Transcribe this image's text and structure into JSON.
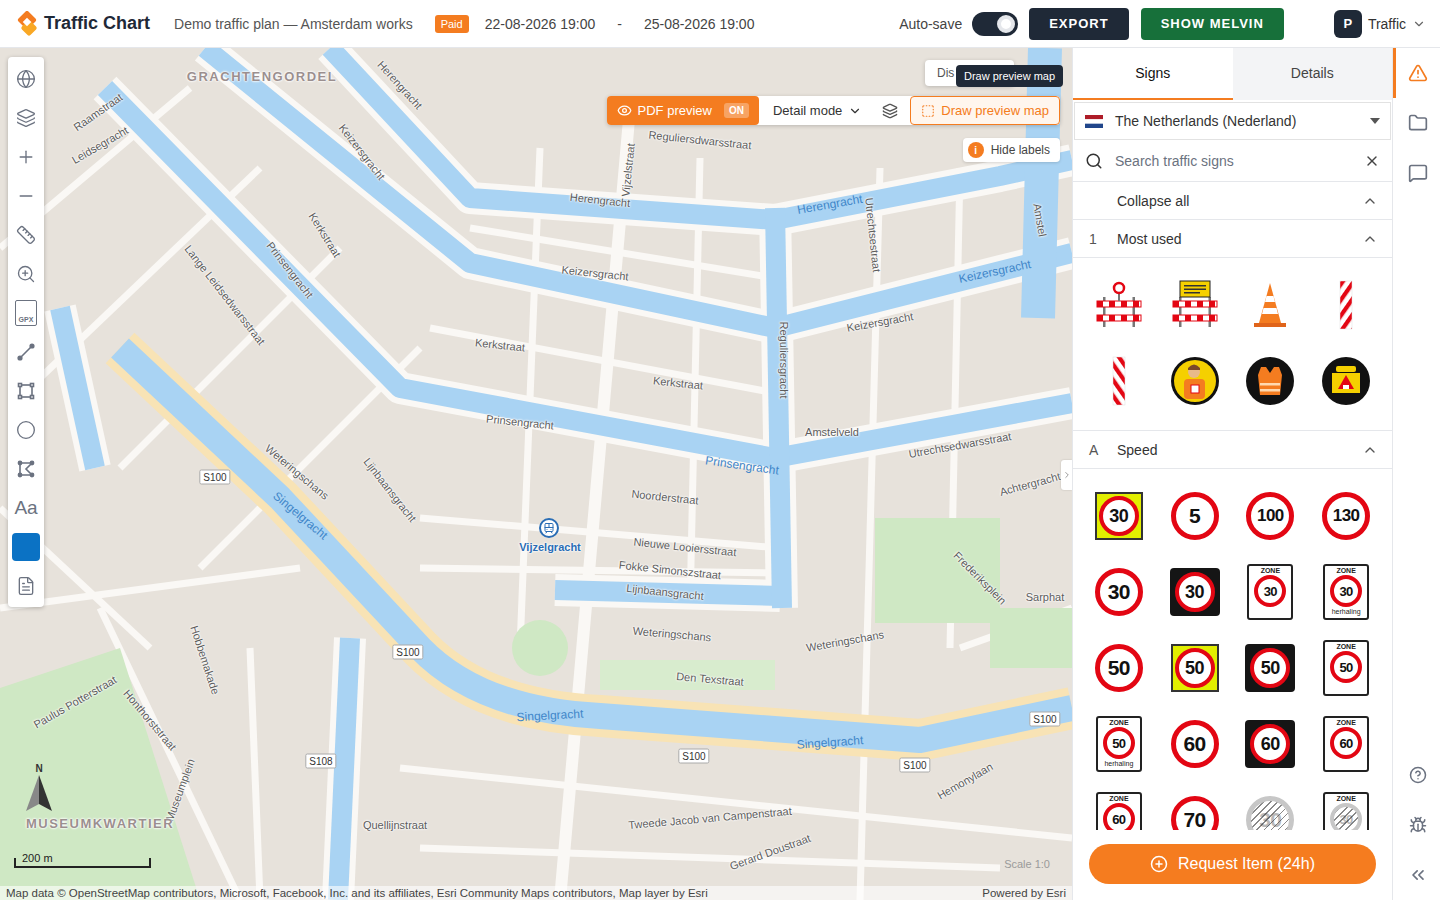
{
  "header": {
    "logo": "Traffic Chart",
    "plan_title": "Demo traffic plan — Amsterdam works",
    "status_badge": "Paid",
    "start": "22-08-2026 19:00",
    "separator": "-",
    "end": "25-08-2026 19:00",
    "autosave": {
      "label": "Auto-save",
      "on": true
    },
    "export_button": "EXPORT",
    "melvin_button": "SHOW MELVIN",
    "user": {
      "initial": "P",
      "name": "Traffic"
    }
  },
  "map": {
    "toolbar": {
      "pdf_preview": {
        "label": "PDF preview",
        "state": "ON",
        "on": true
      },
      "detail_mode": "Detail mode",
      "draw_preview": "Draw preview map"
    },
    "hidden_button": "Dis",
    "tooltip": "Draw preview map",
    "hide_labels": {
      "icon": "i",
      "label": "Hide labels"
    },
    "tools": [
      {
        "kind": "icon"
      },
      {
        "kind": "icon"
      },
      {
        "kind": "icon"
      },
      {
        "kind": "icon"
      },
      {
        "kind": "icon"
      },
      {
        "kind": "icon"
      },
      {
        "kind": "gpx",
        "label": "GPX"
      },
      {
        "kind": "icon"
      },
      {
        "kind": "icon"
      },
      {
        "kind": "icon"
      },
      {
        "kind": "icon"
      },
      {
        "kind": "text",
        "label": "Aa"
      },
      {
        "kind": "color",
        "color": "#0b72c4"
      },
      {
        "kind": "icon"
      }
    ],
    "labels": [
      {
        "text": "GRACHTENGORDEL",
        "kind": "district"
      },
      {
        "text": "Herengracht",
        "kind": "street"
      },
      {
        "text": "Raamstraat",
        "kind": "street"
      },
      {
        "text": "Keizersgracht",
        "kind": "street"
      },
      {
        "text": "Leidsegracht",
        "kind": "street"
      },
      {
        "text": "Herengracht",
        "kind": "street"
      },
      {
        "text": "Reguliersdwarsstraat",
        "kind": "street"
      },
      {
        "text": "Herengracht",
        "kind": "canal"
      },
      {
        "text": "Keizersgracht",
        "kind": "street"
      },
      {
        "text": "Kerkstraat",
        "kind": "street"
      },
      {
        "text": "Prinsengracht",
        "kind": "street"
      },
      {
        "text": "Lange Leidsedwarsstraat",
        "kind": "street"
      },
      {
        "text": "Kerkstraat",
        "kind": "street"
      },
      {
        "text": "Keizersgracht",
        "kind": "street"
      },
      {
        "text": "Keizersgracht",
        "kind": "canal"
      },
      {
        "text": "Prinsengracht",
        "kind": "street"
      },
      {
        "text": "Kerkstraat",
        "kind": "street"
      },
      {
        "text": "Prinsengracht",
        "kind": "canal"
      },
      {
        "text": "Amstelveld",
        "kind": "street"
      },
      {
        "text": "Utrechtsedwarsstraat",
        "kind": "street"
      },
      {
        "text": "Reguliersgracht",
        "kind": "street"
      },
      {
        "text": "Utrechtsestraat",
        "kind": "street"
      },
      {
        "text": "Vijzelstraat",
        "kind": "street"
      },
      {
        "text": "Noorderstraat",
        "kind": "street"
      },
      {
        "text": "Nieuwe Looiersstraat",
        "kind": "street"
      },
      {
        "text": "Fokke Simonszstraat",
        "kind": "street"
      },
      {
        "text": "Lijnbaansgracht",
        "kind": "street"
      },
      {
        "text": "Vijzelgracht",
        "kind": "station"
      },
      {
        "text": "Weteringschans",
        "kind": "street"
      },
      {
        "text": "Den Texstraat",
        "kind": "street"
      },
      {
        "text": "Singelgracht",
        "kind": "canal"
      },
      {
        "text": "Singelgracht",
        "kind": "canal"
      },
      {
        "text": "Weteringschans",
        "kind": "street"
      },
      {
        "text": "Frederiksplein",
        "kind": "street"
      },
      {
        "text": "Sarphat",
        "kind": "street"
      },
      {
        "text": "Achtergracht",
        "kind": "street"
      },
      {
        "text": "Hemonylaan",
        "kind": "street"
      },
      {
        "text": "S100",
        "kind": "route"
      },
      {
        "text": "S100",
        "kind": "route"
      },
      {
        "text": "S100",
        "kind": "route"
      },
      {
        "text": "S100",
        "kind": "route"
      },
      {
        "text": "S100",
        "kind": "route"
      },
      {
        "text": "S108",
        "kind": "route"
      },
      {
        "text": "Weteringschans",
        "kind": "street"
      },
      {
        "text": "Singelgracht",
        "kind": "canal"
      },
      {
        "text": "Lijnbaansgracht",
        "kind": "street"
      },
      {
        "text": "Hobbemakade",
        "kind": "street"
      },
      {
        "text": "Honthorststraat",
        "kind": "street"
      },
      {
        "text": "Paulus Potterstraat",
        "kind": "street"
      },
      {
        "text": "Museumplein",
        "kind": "street"
      },
      {
        "text": "MUSEUMKWARTIER",
        "kind": "district"
      },
      {
        "text": "Quellijnstraat",
        "kind": "street"
      },
      {
        "text": "Tweede Jacob van Campenstraat",
        "kind": "street"
      },
      {
        "text": "Gerard Doustraat",
        "kind": "street"
      },
      {
        "text": "Amstel",
        "kind": "street"
      }
    ],
    "compass": "N",
    "scale": "200 m",
    "scale_label": "Scale 1:0",
    "attribution": "Map data © OpenStreetMap contributors, Microsoft, Facebook, Inc. and its affiliates, Esri Community Maps contributors, Map layer by Esri",
    "powered_by": "Powered by Esri"
  },
  "panel": {
    "tabs": [
      {
        "label": "Signs",
        "selected": true
      },
      {
        "label": "Details",
        "selected": false
      }
    ],
    "country": "The Netherlands (Nederland)",
    "search": {
      "placeholder": "Search traffic signs"
    },
    "collapse_all": "Collapse all",
    "sections": [
      {
        "key": "1",
        "title": "Most used",
        "expanded": true,
        "items": [
          {
            "kind": "barrier-lamp"
          },
          {
            "kind": "barrier-sign"
          },
          {
            "kind": "cone"
          },
          {
            "kind": "beacon-right"
          },
          {
            "kind": "beacon-left"
          },
          {
            "kind": "flagman"
          },
          {
            "kind": "vest"
          },
          {
            "kind": "worker"
          }
        ]
      },
      {
        "key": "A",
        "title": "Speed",
        "expanded": true,
        "items": [
          {
            "kind": "round-yellow",
            "value": "30"
          },
          {
            "kind": "round",
            "value": "5"
          },
          {
            "kind": "round",
            "value": "100"
          },
          {
            "kind": "round",
            "value": "130"
          },
          {
            "kind": "round",
            "value": "30"
          },
          {
            "kind": "round-black",
            "value": "30"
          },
          {
            "kind": "zone",
            "value": "30",
            "top": "ZONE"
          },
          {
            "kind": "zone",
            "value": "30",
            "top": "ZONE",
            "bottom": "herhaling"
          },
          {
            "kind": "round",
            "value": "50"
          },
          {
            "kind": "round-yellow",
            "value": "50"
          },
          {
            "kind": "round-black",
            "value": "50"
          },
          {
            "kind": "zone",
            "value": "50",
            "top": "ZONE"
          },
          {
            "kind": "zone",
            "value": "50",
            "top": "ZONE",
            "bottom": "herhaling"
          },
          {
            "kind": "round",
            "value": "60"
          },
          {
            "kind": "round-black",
            "value": "60"
          },
          {
            "kind": "zone",
            "value": "60",
            "top": "ZONE"
          },
          {
            "kind": "zone",
            "value": "60",
            "top": "ZONE"
          },
          {
            "kind": "round",
            "value": "70"
          },
          {
            "kind": "end",
            "value": "30"
          },
          {
            "kind": "zone-end",
            "value": "30",
            "top": "ZONE"
          }
        ]
      }
    ],
    "request_button": "Request Item (24h)"
  },
  "rail": {
    "items": [
      {
        "selected": true
      },
      {
        "selected": false
      },
      {
        "selected": false
      }
    ]
  }
}
